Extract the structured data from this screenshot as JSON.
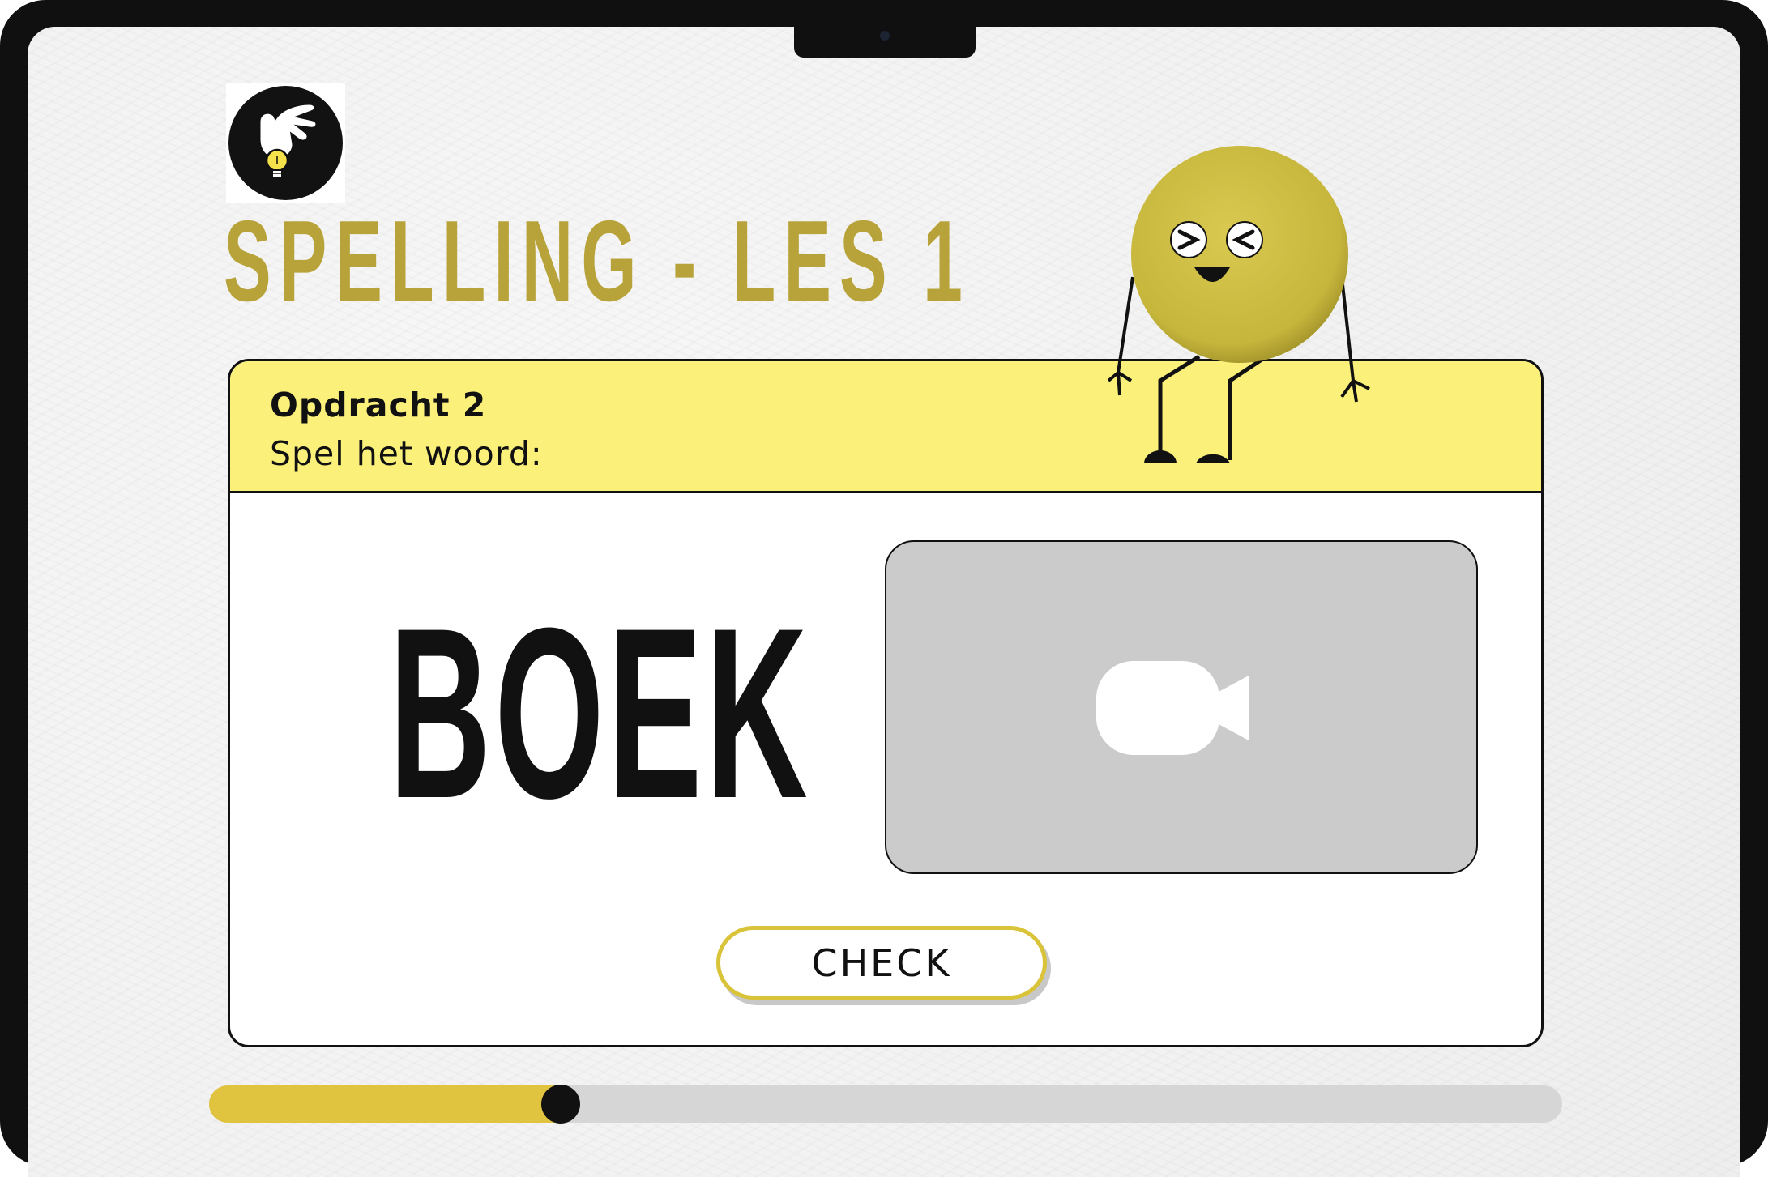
{
  "header": {
    "logo_icon": "hand-lightbulb-icon",
    "title": "SPELLING - LES 1"
  },
  "exercise": {
    "task_number": "Opdracht 2",
    "instruction": "Spel het woord:",
    "word": "BOEK",
    "video_icon": "video-camera-icon",
    "check_label": "CHECK"
  },
  "mascot": {
    "icon": "smiling-yellow-ball-character"
  },
  "progress": {
    "fraction": 0.26
  },
  "colors": {
    "title": "#b8a33a",
    "header_band": "#faf07a",
    "accent": "#e0c43f",
    "video_placeholder": "#cbcbcb"
  }
}
